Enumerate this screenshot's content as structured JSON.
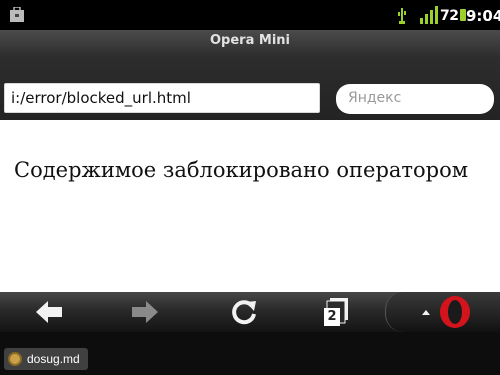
{
  "status_bar": {
    "battery_level": "72",
    "time": "9:04",
    "icons": [
      "briefcase-icon",
      "usb-icon",
      "signal-icon",
      "battery-icon"
    ]
  },
  "browser": {
    "app_title": "Opera Mini",
    "address": "i:/error/blocked_url.html",
    "search_placeholder": "Яндекс"
  },
  "page": {
    "message": "Содержимое заблокировано оператором"
  },
  "toolbar": {
    "buttons": [
      "back-arrow-icon",
      "forward-arrow-icon",
      "reload-icon",
      "tabs-icon",
      "opera-menu-icon"
    ],
    "tab_count": "2"
  },
  "watermark": {
    "text": "dosug.md"
  },
  "colors": {
    "opera_red": "#d4141c",
    "battery_green": "#9bd12a"
  }
}
